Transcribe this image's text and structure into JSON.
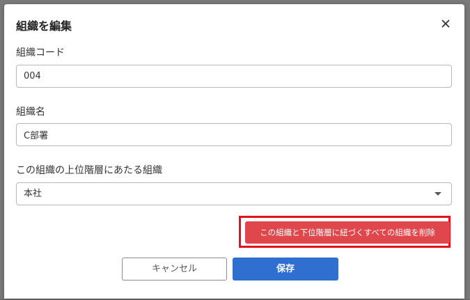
{
  "dialog": {
    "title": "組織を編集",
    "close_icon": "close-icon"
  },
  "form": {
    "org_code": {
      "label": "組織コード",
      "value": "004"
    },
    "org_name": {
      "label": "組織名",
      "value": "C部署"
    },
    "parent_org": {
      "label": "この組織の上位階層にあたる組織",
      "selected": "本社"
    }
  },
  "actions": {
    "delete_label": "この組織と下位階層に紐づくすべての組織を削除",
    "cancel_label": "キャンセル",
    "save_label": "保存"
  },
  "background": {
    "partial_text": "004"
  },
  "colors": {
    "primary": "#2e6fd0",
    "danger": "#e0474c",
    "highlight_outline": "#e5101a"
  }
}
